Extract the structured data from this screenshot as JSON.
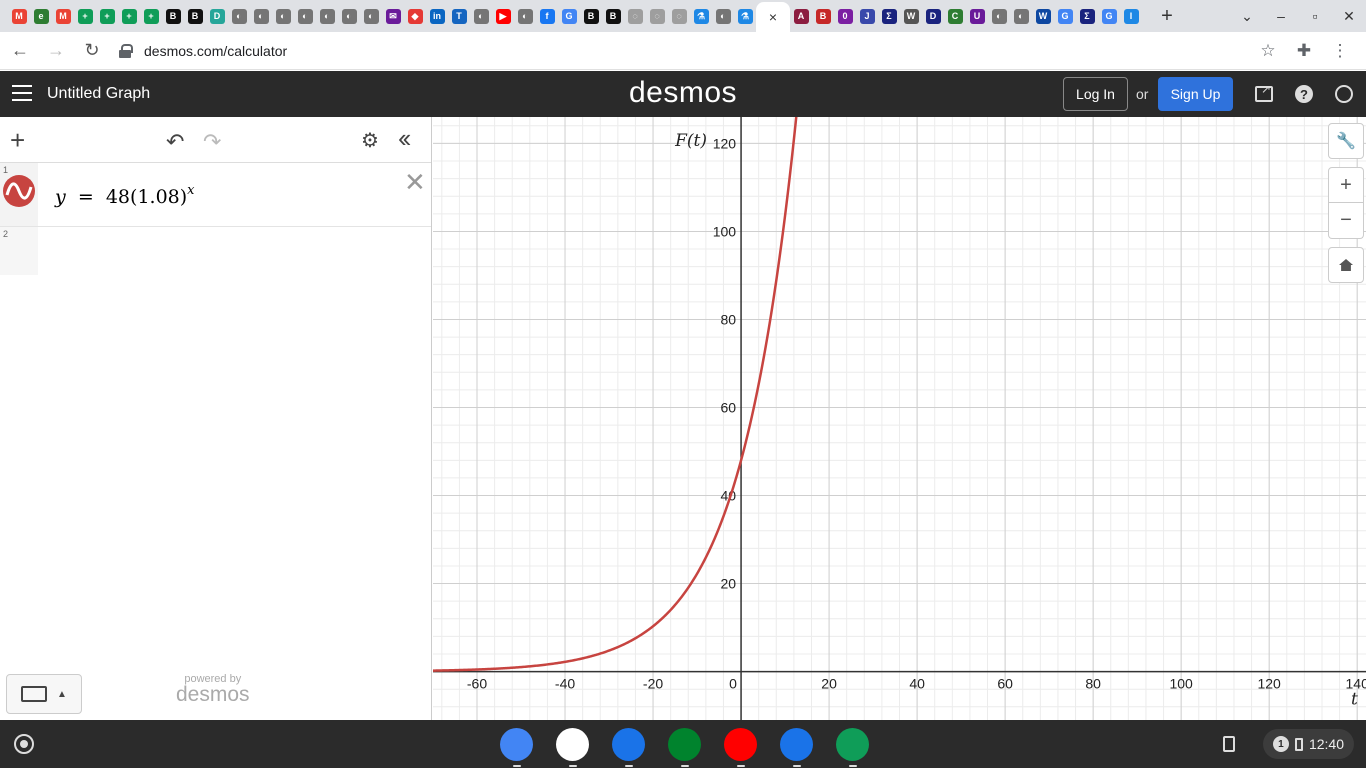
{
  "browser": {
    "tabs": [
      {
        "icon": "gmail-icon",
        "color": "#ea4335",
        "glyph": "M"
      },
      {
        "icon": "edu-icon",
        "color": "#2e7d32",
        "glyph": "e"
      },
      {
        "icon": "gmail-icon",
        "color": "#ea4335",
        "glyph": "M"
      },
      {
        "icon": "classroom-icon",
        "color": "#0f9d58",
        "glyph": "+"
      },
      {
        "icon": "classroom-icon",
        "color": "#0f9d58",
        "glyph": "+"
      },
      {
        "icon": "classroom-icon",
        "color": "#0f9d58",
        "glyph": "+"
      },
      {
        "icon": "classroom-icon",
        "color": "#0f9d58",
        "glyph": "+"
      },
      {
        "icon": "bold-icon",
        "color": "#111111",
        "glyph": "B"
      },
      {
        "icon": "bold-icon",
        "color": "#111111",
        "glyph": "B"
      },
      {
        "icon": "document-icon",
        "color": "#26a69a",
        "glyph": "D"
      },
      {
        "icon": "globe-icon",
        "color": "#757575",
        "glyph": "◐"
      },
      {
        "icon": "globe-icon",
        "color": "#757575",
        "glyph": "◐"
      },
      {
        "icon": "globe-icon",
        "color": "#757575",
        "glyph": "◐"
      },
      {
        "icon": "globe-icon",
        "color": "#757575",
        "glyph": "◐"
      },
      {
        "icon": "globe-icon",
        "color": "#757575",
        "glyph": "◐"
      },
      {
        "icon": "globe-icon",
        "color": "#757575",
        "glyph": "◐"
      },
      {
        "icon": "globe-icon",
        "color": "#757575",
        "glyph": "◐"
      },
      {
        "icon": "mail-icon",
        "color": "#6a1b9a",
        "glyph": "✉"
      },
      {
        "icon": "diamond-icon",
        "color": "#e53935",
        "glyph": "◆"
      },
      {
        "icon": "linkedin-icon",
        "color": "#0a66c2",
        "glyph": "in"
      },
      {
        "icon": "tps-icon",
        "color": "#1565c0",
        "glyph": "T"
      },
      {
        "icon": "globe-icon",
        "color": "#757575",
        "glyph": "◐"
      },
      {
        "icon": "youtube-icon",
        "color": "#ff0000",
        "glyph": "▶"
      },
      {
        "icon": "globe-icon",
        "color": "#757575",
        "glyph": "◐"
      },
      {
        "icon": "facebook-icon",
        "color": "#1877f2",
        "glyph": "f"
      },
      {
        "icon": "google-icon",
        "color": "#4285f4",
        "glyph": "G"
      },
      {
        "icon": "bold-icon",
        "color": "#111111",
        "glyph": "B"
      },
      {
        "icon": "bold-icon",
        "color": "#111111",
        "glyph": "B"
      },
      {
        "icon": "swirl-icon",
        "color": "#9e9e9e",
        "glyph": "◌"
      },
      {
        "icon": "swirl-icon",
        "color": "#9e9e9e",
        "glyph": "◌"
      },
      {
        "icon": "swirl-icon",
        "color": "#9e9e9e",
        "glyph": "◌"
      },
      {
        "icon": "flask-icon",
        "color": "#1e88e5",
        "glyph": "⚗"
      },
      {
        "icon": "globe-icon",
        "color": "#757575",
        "glyph": "◐"
      },
      {
        "icon": "flask-icon",
        "color": "#1e88e5",
        "glyph": "⚗"
      },
      {
        "icon": "asu-icon",
        "color": "#8c1d40",
        "glyph": "A"
      },
      {
        "icon": "book-icon",
        "color": "#c62828",
        "glyph": "B"
      },
      {
        "icon": "circle-icon",
        "color": "#7b1fa2",
        "glyph": "0"
      },
      {
        "icon": "jw-icon",
        "color": "#3949ab",
        "glyph": "J"
      },
      {
        "icon": "sigma-icon",
        "color": "#1a237e",
        "glyph": "Σ"
      },
      {
        "icon": "wikipedia-icon",
        "color": "#555555",
        "glyph": "W"
      },
      {
        "icon": "desmos-icon",
        "color": "#1a237e",
        "glyph": "D"
      },
      {
        "icon": "cmg-icon",
        "color": "#2e7d32",
        "glyph": "C"
      },
      {
        "icon": "shield-icon",
        "color": "#6a1b9a",
        "glyph": "U"
      },
      {
        "icon": "globe-icon",
        "color": "#757575",
        "glyph": "◐"
      },
      {
        "icon": "globe-icon",
        "color": "#757575",
        "glyph": "◐"
      },
      {
        "icon": "wave-icon",
        "color": "#0d47a1",
        "glyph": "W"
      },
      {
        "icon": "google-icon",
        "color": "#4285f4",
        "glyph": "G"
      },
      {
        "icon": "sigma-icon",
        "color": "#1a237e",
        "glyph": "Σ"
      },
      {
        "icon": "google-icon",
        "color": "#4285f4",
        "glyph": "G"
      },
      {
        "icon": "bar-icon",
        "color": "#1e88e5",
        "glyph": "l"
      }
    ],
    "active_tab": {
      "icon": "desmos-icon",
      "close": "×"
    },
    "new_tab": "+",
    "url": "desmos.com/calculator"
  },
  "desmos": {
    "title": "Untitled Graph",
    "logo": "desmos",
    "login": "Log In",
    "or": "or",
    "signup": "Sign Up",
    "colors": {
      "header": "#2a2a2a",
      "signup": "#2f72dc",
      "curve": "#c74440"
    }
  },
  "expressions": [
    {
      "number": "1",
      "lhs": "y",
      "equals": "=",
      "coef": "48",
      "base": "(1.08)",
      "exponent": "x"
    },
    {
      "number": "2"
    }
  ],
  "powered_by": {
    "line1": "powered by",
    "line2": "desmos"
  },
  "graph": {
    "x_axis_label": "t",
    "y_axis_label": "F(t)",
    "x_ticks": [
      "-60",
      "-40",
      "-20",
      "0",
      "20",
      "40",
      "60",
      "80",
      "100",
      "120",
      "140"
    ],
    "y_ticks": [
      "20",
      "40",
      "60",
      "80",
      "100",
      "120"
    ]
  },
  "chart_data": {
    "type": "line",
    "series": [
      {
        "name": "y = 48(1.08)^x",
        "function": "48*(1.08)^x",
        "color": "#c74440"
      }
    ],
    "xlabel": "t",
    "ylabel": "F(t)",
    "xlim": [
      -70,
      142
    ],
    "ylim": [
      -11,
      126
    ],
    "x_ticks": [
      -60,
      -40,
      -20,
      0,
      20,
      40,
      60,
      80,
      100,
      120,
      140
    ],
    "y_ticks": [
      20,
      40,
      60,
      80,
      100,
      120
    ],
    "grid": true
  },
  "shelf": {
    "apps": [
      {
        "icon": "chrome-icon",
        "color": "#4285f4"
      },
      {
        "icon": "gmail-icon",
        "color": "#ffffff"
      },
      {
        "icon": "files-icon",
        "color": "#1a73e8"
      },
      {
        "icon": "meet-icon",
        "color": "#00832d"
      },
      {
        "icon": "youtube-icon",
        "color": "#ff0000"
      },
      {
        "icon": "messages-icon",
        "color": "#1a73e8"
      },
      {
        "icon": "sheets-icon",
        "color": "#0f9d58"
      }
    ],
    "notification_count": "1",
    "time": "12:40"
  }
}
